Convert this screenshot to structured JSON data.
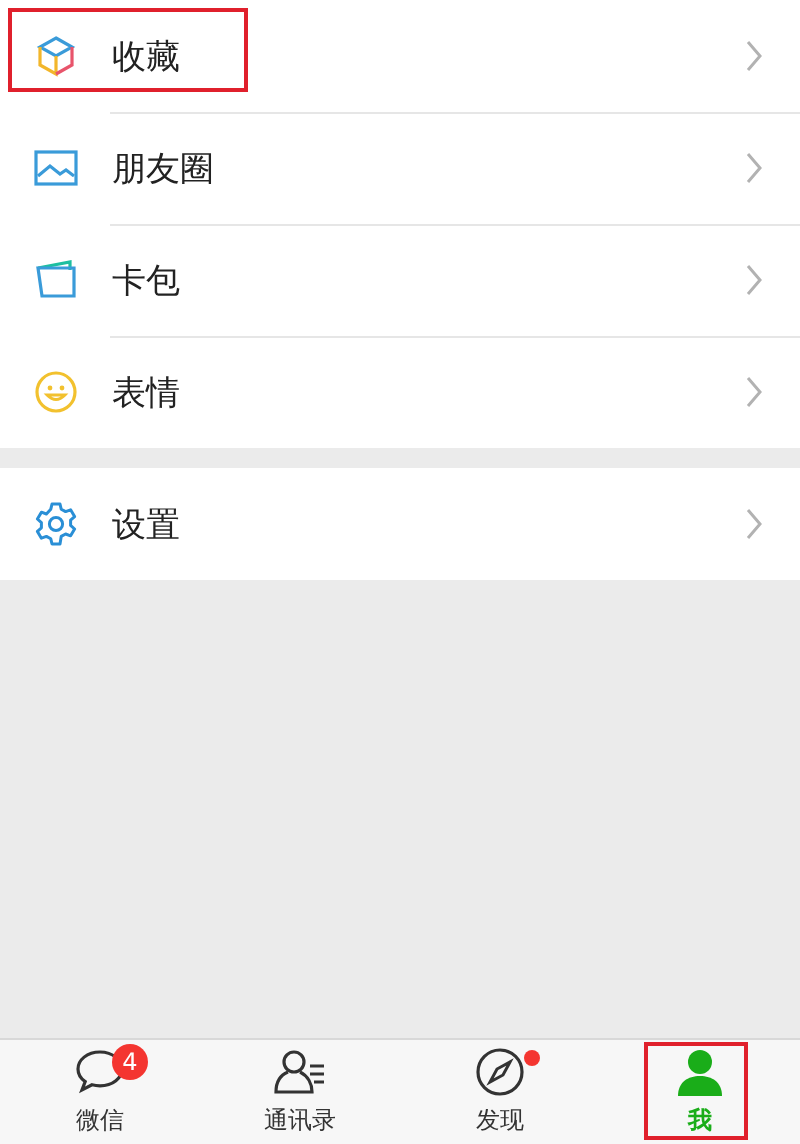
{
  "menu_groups": [
    {
      "items": [
        {
          "label": "收藏",
          "highlighted": true
        },
        {
          "label": "朋友圈",
          "highlighted": false
        },
        {
          "label": "卡包",
          "highlighted": false
        },
        {
          "label": "表情",
          "highlighted": false
        }
      ]
    },
    {
      "items": [
        {
          "label": "设置",
          "highlighted": false
        }
      ]
    }
  ],
  "tabs": [
    {
      "label": "微信",
      "selected": false,
      "badge": "4",
      "dot": false,
      "highlighted": false
    },
    {
      "label": "通讯录",
      "selected": false,
      "dot": false,
      "highlighted": false
    },
    {
      "label": "发现",
      "selected": false,
      "dot": true,
      "highlighted": false
    },
    {
      "label": "我",
      "selected": true,
      "dot": false,
      "highlighted": true
    }
  ]
}
